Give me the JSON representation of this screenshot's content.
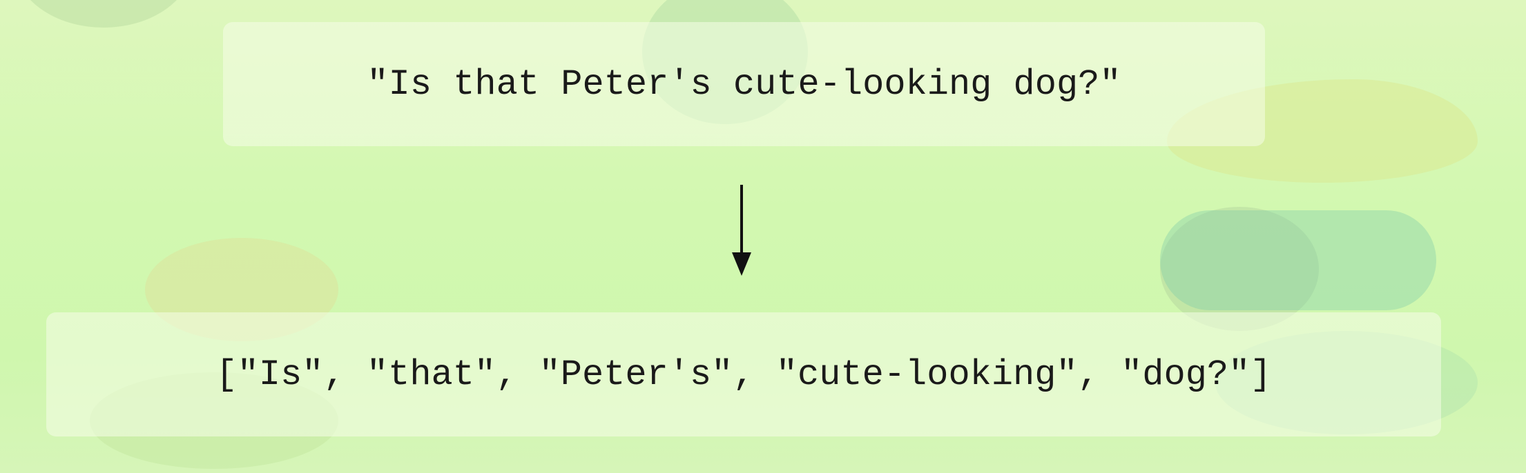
{
  "diagram": {
    "input_text": "\"Is that Peter's cute-looking dog?\"",
    "output_text": "[\"Is\", \"that\", \"Peter's\", \"cute-looking\", \"dog?\"]",
    "arrow_direction": "down",
    "colors": {
      "background": "#d2f8b0",
      "panel": "#f2fbe1",
      "text": "#1a1a1a",
      "arrow": "#111111"
    }
  }
}
